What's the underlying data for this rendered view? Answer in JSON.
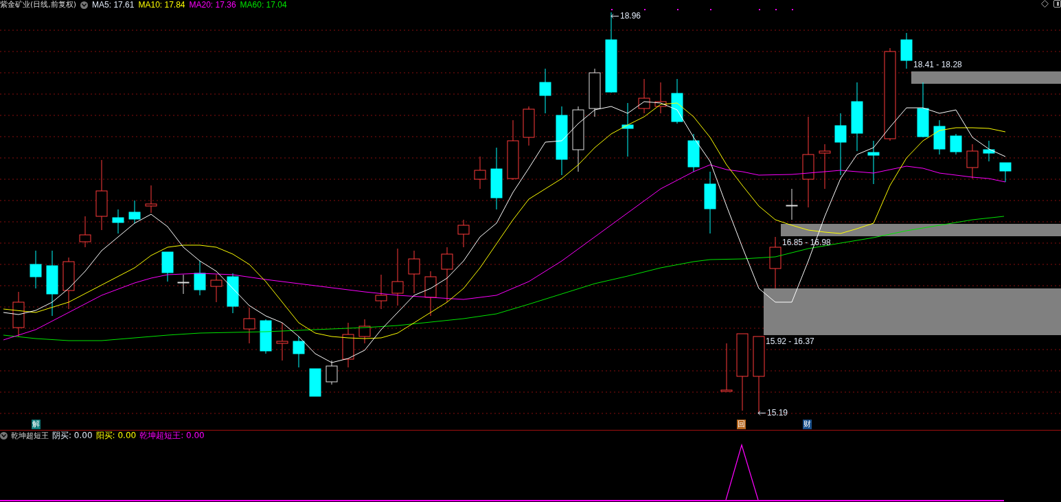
{
  "header": {
    "title": "紫金矿业(日线,前复权)",
    "ma_items": [
      {
        "label": "MA5: 17.61",
        "color": "#dfe8f5"
      },
      {
        "label": "MA10: 17.84",
        "color": "#ffff00"
      },
      {
        "label": "MA20: 17.36",
        "color": "#ff00ff"
      },
      {
        "label": "MA60: 17.04",
        "color": "#00e600"
      }
    ]
  },
  "price_labels": [
    {
      "kind": "arrow",
      "text": "18.96"
    },
    {
      "kind": "range",
      "text": "18.41 - 18.28"
    },
    {
      "kind": "range",
      "text": "16.85 - 16.98"
    },
    {
      "kind": "range",
      "text": "15.92 - 16.37"
    },
    {
      "kind": "arrow",
      "text": "15.19"
    }
  ],
  "signal_markers": [
    {
      "text": "解",
      "color": "#0e7a7a"
    },
    {
      "text": "回",
      "color": "#b5651d"
    },
    {
      "text": "财",
      "color": "#1a4f8a"
    }
  ],
  "indicator": {
    "title": "乾坤超短王",
    "items": [
      {
        "label": "阴买: 0.00",
        "color": "#dfe8f5"
      },
      {
        "label": "阳买: 0.00",
        "color": "#ffff00"
      },
      {
        "label": "乾坤超短王: 0.00",
        "color": "#ff00ff"
      }
    ]
  }
}
